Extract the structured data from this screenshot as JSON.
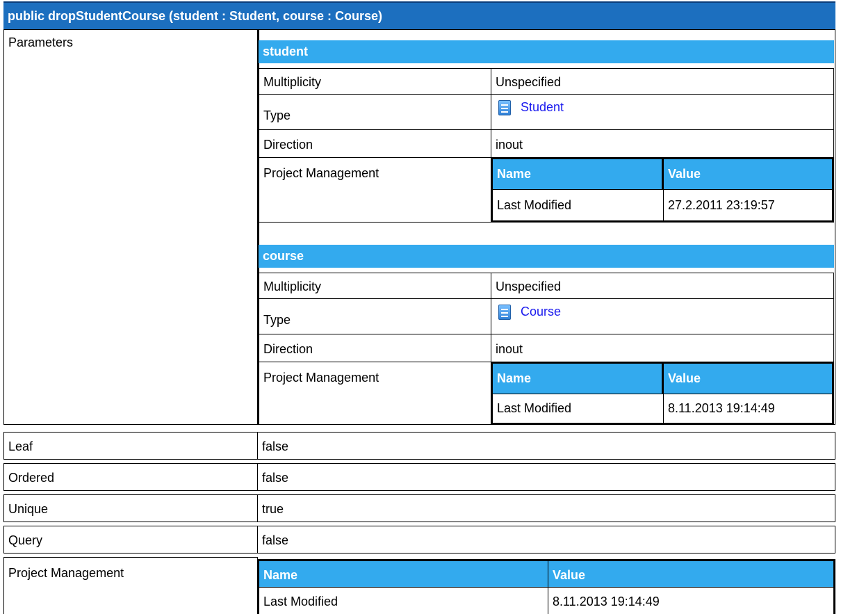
{
  "title": "public dropStudentCourse (student : Student, course : Course)",
  "parameters_label": "Parameters",
  "params": [
    {
      "name": "student",
      "multiplicity_label": "Multiplicity",
      "multiplicity": "Unspecified",
      "type_label": "Type",
      "type": "Student",
      "type_icon": "class-icon",
      "direction_label": "Direction",
      "direction": "inout",
      "pm_label": "Project Management",
      "pm_headers": {
        "name": "Name",
        "value": "Value"
      },
      "pm_row": {
        "name": "Last Modified",
        "value": "27.2.2011 23:19:57"
      }
    },
    {
      "name": "course",
      "multiplicity_label": "Multiplicity",
      "multiplicity": "Unspecified",
      "type_label": "Type",
      "type": "Course",
      "type_icon": "class-icon",
      "direction_label": "Direction",
      "direction": "inout",
      "pm_label": "Project Management",
      "pm_headers": {
        "name": "Name",
        "value": "Value"
      },
      "pm_row": {
        "name": "Last Modified",
        "value": "8.11.2013 19:14:49"
      }
    }
  ],
  "props": [
    {
      "label": "Leaf",
      "value": "false"
    },
    {
      "label": "Ordered",
      "value": "false"
    },
    {
      "label": "Unique",
      "value": "true"
    },
    {
      "label": "Query",
      "value": "false"
    }
  ],
  "project_management": {
    "label": "Project Management",
    "headers": {
      "name": "Name",
      "value": "Value"
    },
    "row": {
      "name": "Last Modified",
      "value": "8.11.2013 19:14:49"
    }
  },
  "colors": {
    "title_bg": "#1c6fbf",
    "header_bg": "#33aaee",
    "link": "#1a1aee"
  }
}
